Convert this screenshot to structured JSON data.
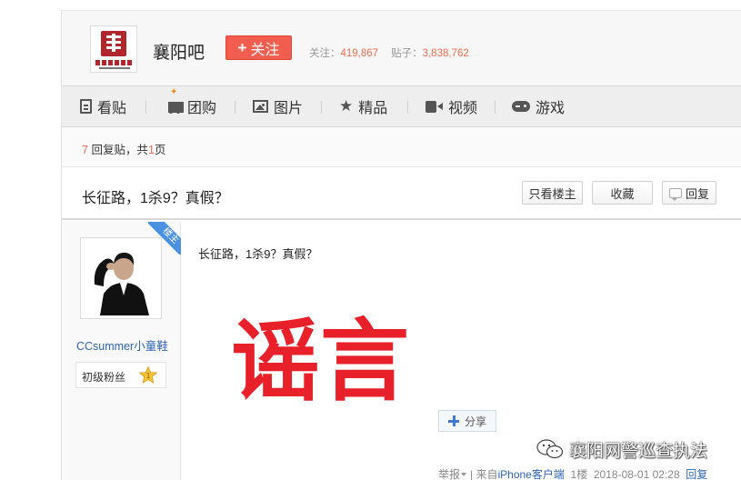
{
  "forum": {
    "name": "襄阳吧",
    "follow_label": "关注",
    "followers_label": "关注：",
    "followers_count": "419,867",
    "posts_label": "贴子：",
    "posts_count": "3,838,762"
  },
  "nav": {
    "items": [
      {
        "label": "看贴",
        "icon": "document-icon"
      },
      {
        "label": "团购",
        "icon": "cart-icon"
      },
      {
        "label": "图片",
        "icon": "picture-icon"
      },
      {
        "label": "精品",
        "icon": "star-icon"
      },
      {
        "label": "视频",
        "icon": "video-icon"
      },
      {
        "label": "游戏",
        "icon": "gamepad-icon"
      }
    ]
  },
  "reply_summary": {
    "count": "7",
    "text_middle": "回复贴，共",
    "pages": "1",
    "text_end": "页"
  },
  "thread": {
    "title": "长征路，1杀9？真假？",
    "only_owner_label": "只看楼主",
    "favorite_label": "收藏",
    "reply_label": "回复"
  },
  "author": {
    "username": "CCsummer小童鞋",
    "level_name": "初级粉丝",
    "level_number": "1",
    "owner_badge": "楼主"
  },
  "post": {
    "text": "长征路，1杀9？真假？",
    "image_text": "谣言",
    "share_label": "分享",
    "report_label": "举报",
    "source_prefix": "| 来自",
    "source_client": "iPhone客户端",
    "floor": "1楼",
    "timestamp": "2018-08-01 02:28",
    "reply_label": "回复"
  },
  "watermark": {
    "text": "襄阳网警巡查执法"
  },
  "colors": {
    "follow_button": "#f15e4f",
    "stat_number": "#f36c4d",
    "username": "#2d64b3",
    "rumor_text": "#e8202a",
    "owner_ribbon": "#4a90e2"
  }
}
